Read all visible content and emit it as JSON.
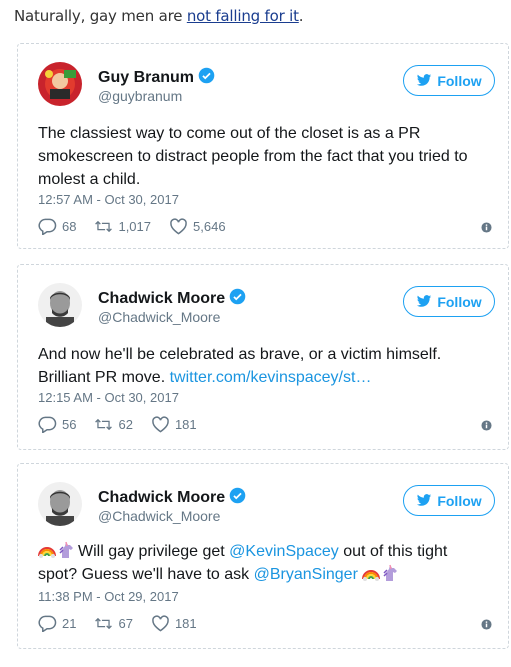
{
  "intro": {
    "prefix": "Naturally, gay men are ",
    "link": "not falling for it",
    "suffix": "."
  },
  "follow_label": "Follow",
  "tweets": [
    {
      "name": "Guy Branum",
      "handle": "@guybranum",
      "text": "The classiest way to come out of the closet is as a PR smokescreen to distract people from the fact that you tried to molest a child.",
      "time": "12:57 AM - Oct 30, 2017",
      "replies": "68",
      "retweets": "1,017",
      "likes": "5,646"
    },
    {
      "name": "Chadwick Moore",
      "handle": "@Chadwick_Moore",
      "text_before": "And now he'll be celebrated as brave, or a victim himself. Brilliant PR move. ",
      "text_link": "twitter.com/kevinspacey/st…",
      "time": "12:15 AM - Oct 30, 2017",
      "replies": "56",
      "retweets": "62",
      "likes": "181"
    },
    {
      "name": "Chadwick Moore",
      "handle": "@Chadwick_Moore",
      "text_part1": "Will gay privilege get ",
      "mention1": "@KevinSpacey",
      "text_part2": " out of this tight spot? Guess we'll have to ask ",
      "mention2": "@BryanSinger",
      "time": "11:38 PM - Oct 29, 2017",
      "replies": "21",
      "retweets": "67",
      "likes": "181"
    }
  ],
  "colors": {
    "accent": "#1da1f2",
    "link": "#1b95e0",
    "muted": "#657786"
  }
}
